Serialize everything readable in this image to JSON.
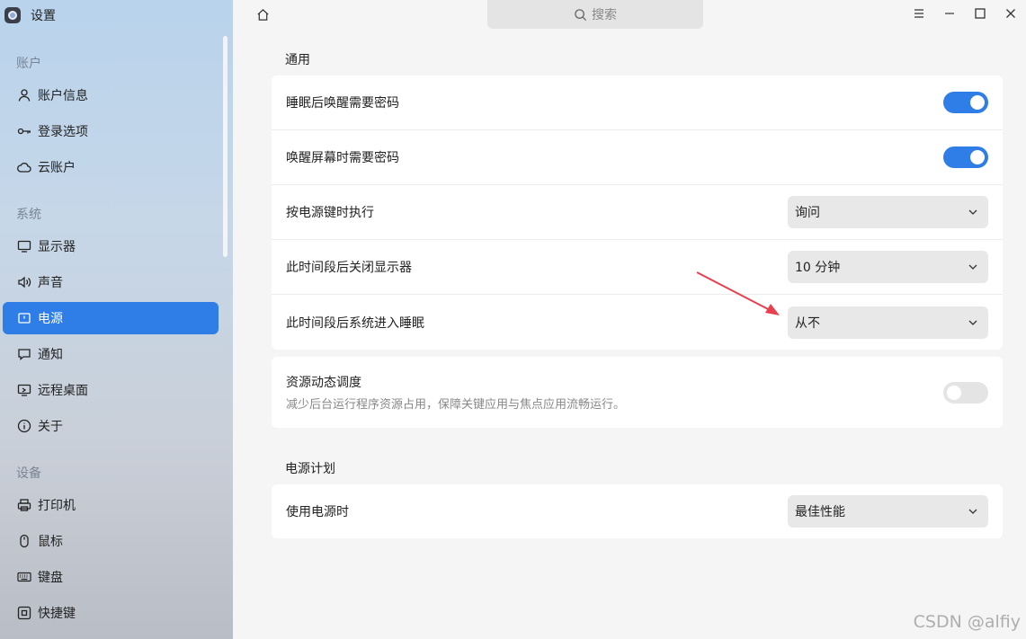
{
  "app": {
    "title": "设置"
  },
  "sidebar": {
    "sections": [
      {
        "title": "账户",
        "items": [
          {
            "label": "账户信息",
            "icon": "user-icon"
          },
          {
            "label": "登录选项",
            "icon": "key-icon"
          },
          {
            "label": "云账户",
            "icon": "cloud-icon"
          }
        ]
      },
      {
        "title": "系统",
        "items": [
          {
            "label": "显示器",
            "icon": "monitor-icon"
          },
          {
            "label": "声音",
            "icon": "speaker-icon"
          },
          {
            "label": "电源",
            "icon": "power-icon",
            "active": true
          },
          {
            "label": "通知",
            "icon": "message-icon"
          },
          {
            "label": "远程桌面",
            "icon": "remote-desktop-icon"
          },
          {
            "label": "关于",
            "icon": "info-icon"
          }
        ]
      },
      {
        "title": "设备",
        "items": [
          {
            "label": "打印机",
            "icon": "printer-icon"
          },
          {
            "label": "鼠标",
            "icon": "mouse-icon"
          },
          {
            "label": "键盘",
            "icon": "keyboard-icon"
          },
          {
            "label": "快捷键",
            "icon": "shortcut-icon"
          }
        ]
      }
    ]
  },
  "search": {
    "placeholder": "搜索"
  },
  "general": {
    "title": "通用",
    "rows": [
      {
        "label": "睡眠后唤醒需要密码",
        "type": "toggle",
        "on": true
      },
      {
        "label": "唤醒屏幕时需要密码",
        "type": "toggle",
        "on": true
      },
      {
        "label": "按电源键时执行",
        "type": "select",
        "value": "询问"
      },
      {
        "label": "此时间段后关闭显示器",
        "type": "select",
        "value": "10 分钟"
      },
      {
        "label": "此时间段后系统进入睡眠",
        "type": "select",
        "value": "从不"
      }
    ]
  },
  "resource": {
    "label": "资源动态调度",
    "desc": "减少后台运行程序资源占用，保障关键应用与焦点应用流畅运行。",
    "on": false
  },
  "power_plan": {
    "title": "电源计划",
    "rows": [
      {
        "label": "使用电源时",
        "type": "select",
        "value": "最佳性能"
      }
    ]
  },
  "watermark": "CSDN @alfiy",
  "colors": {
    "accent": "#2f7de6",
    "annotation_arrow": "#e8404f"
  }
}
